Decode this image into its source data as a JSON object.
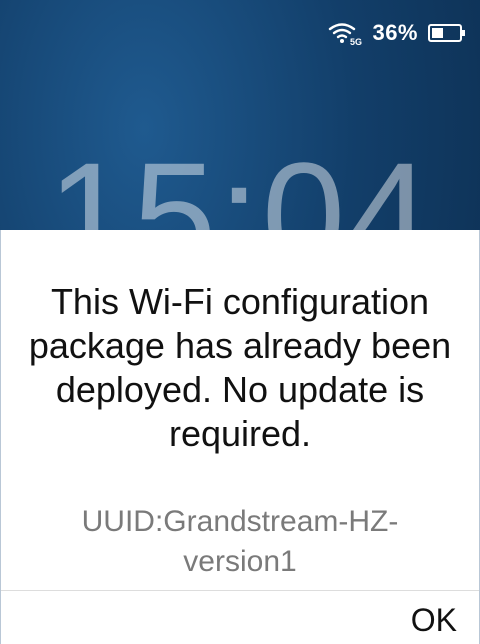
{
  "status_bar": {
    "wifi_label": "5G",
    "battery_percent": "36%",
    "wifi_icon": "wifi-5g-icon",
    "battery_icon": "battery-icon"
  },
  "lock_screen": {
    "time": "15:04"
  },
  "dialog": {
    "message": "This Wi-Fi configuration package has already been deployed. No update is required.",
    "uuid": "UUID:Grandstream-HZ-version1",
    "ok_label": "OK"
  },
  "colors": {
    "background_top": "#1f5a8f",
    "background_bottom": "#0b2a4a",
    "dialog_background": "#ffffff",
    "uuid_text": "#7a7a7a"
  }
}
